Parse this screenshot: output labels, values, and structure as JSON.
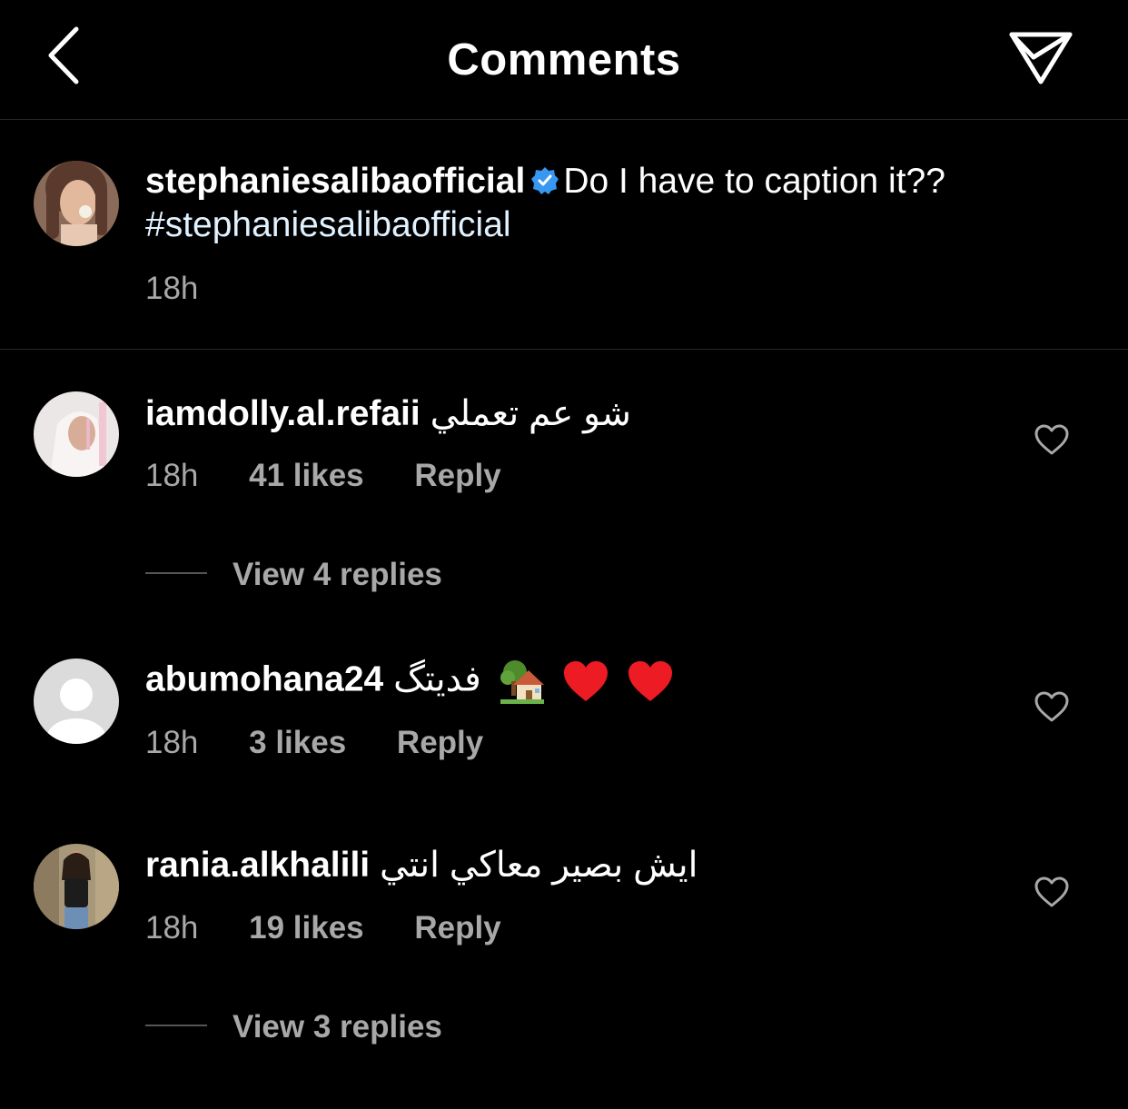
{
  "header": {
    "title": "Comments"
  },
  "caption": {
    "username": "stephaniesalibaofficial",
    "text": "Do I have to caption it??",
    "hashtag": "#stephaniesalibaofficial",
    "time": "18h"
  },
  "comments": [
    {
      "username": "iamdolly.al.refaii",
      "text": "شو عم تعملي",
      "time": "18h",
      "likes": "41 likes",
      "reply": "Reply",
      "view_replies": "View 4 replies"
    },
    {
      "username": "abumohana24",
      "text": "فديتگ",
      "emojis": [
        "house-with-garden-icon",
        "red-heart-icon",
        "red-heart-icon"
      ],
      "time": "18h",
      "likes": "3 likes",
      "reply": "Reply"
    },
    {
      "username": "rania.alkhalili",
      "text": "ايش بصير معاكي انتي",
      "time": "18h",
      "likes": "19 likes",
      "reply": "Reply",
      "view_replies": "View 3 replies"
    }
  ],
  "colors": {
    "background": "#000000",
    "text": "#ffffff",
    "secondary_text": "#a8a8a8",
    "divider": "#262626",
    "verified_blue": "#3897f0",
    "heart_red": "#ed1b24"
  }
}
